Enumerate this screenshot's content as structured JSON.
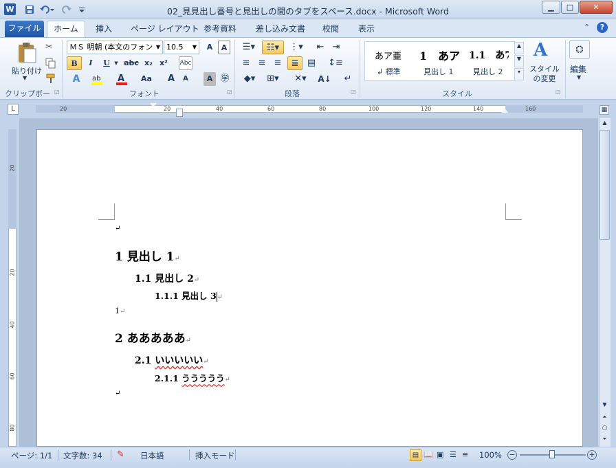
{
  "window": {
    "title": "02_見見出し番号と見出しの間のタブをスペース.docx - Microsoft Word",
    "app_icon": "W"
  },
  "tabs": [
    {
      "label": "ファイル"
    },
    {
      "label": "ホーム"
    },
    {
      "label": "挿入"
    },
    {
      "label": "ページ レイアウト"
    },
    {
      "label": "参考資料"
    },
    {
      "label": "差し込み文書"
    },
    {
      "label": "校閲"
    },
    {
      "label": "表示"
    }
  ],
  "ribbon": {
    "clipboard": {
      "paste_label": "貼り付け",
      "group_label": "クリップボード"
    },
    "font": {
      "name": "ＭＳ 明朝 (本文のフォン",
      "size": "10.5",
      "group_label": "フォント",
      "bold": "B",
      "italic": "I",
      "underline": "U",
      "strike": "abc",
      "sub": "x₂",
      "sup": "x²",
      "grow": "A",
      "shrink": "A",
      "case": "Aa"
    },
    "paragraph": {
      "group_label": "段落"
    },
    "styles": {
      "group_label": "スタイル",
      "items": [
        {
          "preview": "あア亜",
          "name": "↲ 標準"
        },
        {
          "preview": "1　あア",
          "name": "見出し 1"
        },
        {
          "preview": "1.1　あ7",
          "name": "見出し 2"
        }
      ],
      "change_label": "スタイルの変更"
    },
    "editing": {
      "label": "編集"
    }
  },
  "ruler": {
    "labels": [
      "20",
      "20",
      "40",
      "60",
      "80",
      "100",
      "120",
      "140",
      "160"
    ]
  },
  "vruler_labels": [
    "20",
    "20",
    "40",
    "60",
    "80"
  ],
  "document": {
    "para1": "↵",
    "h1a_num": "1",
    "h1a_text": "見出し 1",
    "h2a_num": "1.1",
    "h2a_text": "見出し 2",
    "h3a_num": "1.1.1",
    "h3a_text": "見出し 3",
    "plain": "1",
    "h1b_num": "2",
    "h1b_text": "あああああ",
    "h2b_num": "2.1",
    "h2b_text": "いいいいい",
    "h3b_num": "2.1.1",
    "h3b_text": "ううううう",
    "return_mark": "↵"
  },
  "status": {
    "page": "ページ: 1/1",
    "words": "文字数: 34",
    "language": "日本語",
    "mode": "挿入モード",
    "zoom": "100%"
  }
}
